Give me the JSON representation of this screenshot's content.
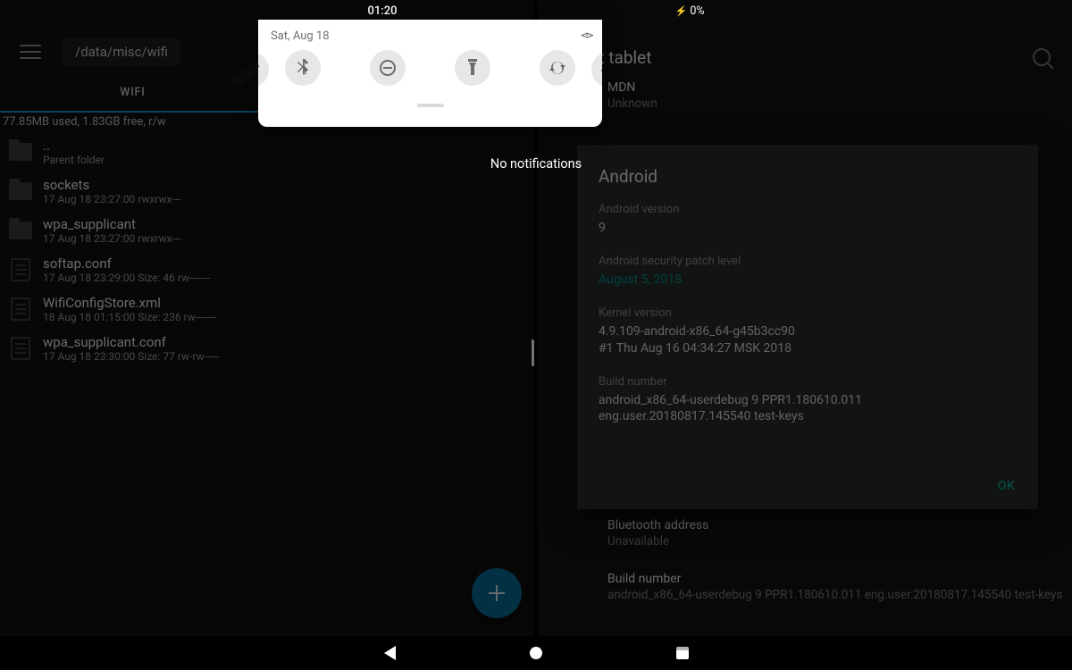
{
  "status": {
    "time": "01:20",
    "battery": "0%",
    "charging_glyph": "⚡"
  },
  "shade": {
    "date": "Sat, Aug 18",
    "tiles": [
      "wifi",
      "bluetooth",
      "dnd",
      "flashlight",
      "rotate",
      "airplane"
    ],
    "no_notifications": "No notifications"
  },
  "fm": {
    "path": "/data/misc/wifi",
    "tab_label": "WIFI",
    "storage": "77.85MB used, 1.83GB free, r/w",
    "rows": [
      {
        "icon": "folder",
        "name": "..",
        "meta": "Parent folder"
      },
      {
        "icon": "folder",
        "name": "sockets",
        "meta": "17 Aug 18 23:27:00   rwxrwx---"
      },
      {
        "icon": "folder",
        "name": "wpa_supplicant",
        "meta": "17 Aug 18 23:27:00   rwxrwx---"
      },
      {
        "icon": "file",
        "name": "softap.conf",
        "meta": "17 Aug 18 23:29:00  Size: 46  rw-------"
      },
      {
        "icon": "file",
        "name": "WifiConfigStore.xml",
        "meta": "18 Aug 18 01:15:00  Size: 236  rw-------"
      },
      {
        "icon": "file",
        "name": "wpa_supplicant.conf",
        "meta": "17 Aug 18 23:30:00  Size: 77  rw-rw-----"
      }
    ]
  },
  "settings": {
    "title": "About tablet",
    "mdn_label": "MDN",
    "mdn_value": "Unknown",
    "bt_label": "Bluetooth address",
    "bt_value": "Unavailable",
    "build_label": "Build number",
    "build_value": "android_x86_64-userdebug 9 PPR1.180610.011 eng.user.20180817.145540 test-keys"
  },
  "dialog": {
    "title": "Android",
    "version_label": "Android version",
    "version_value": "9",
    "patch_label": "Android security patch level",
    "patch_value": "August 5, 2018",
    "kernel_label": "Kernel version",
    "kernel_value": "4.9.109-android-x86_64-g45b3cc90\n#1 Thu Aug 16 04:34:27 MSK 2018",
    "build_label": "Build number",
    "build_value": "android_x86_64-userdebug 9 PPR1.180610.011 eng.user.20180817.145540 test-keys",
    "ok": "OK"
  }
}
